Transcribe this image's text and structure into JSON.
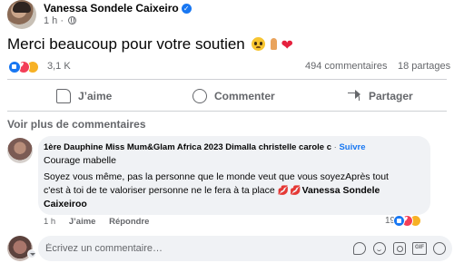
{
  "post": {
    "author": "Vanessa Sondele Caixeiro",
    "time": "1 h",
    "time_sep": "·",
    "text": "Merci beaucoup pour votre soutien",
    "reaction_count": "3,1 K",
    "comments_count": "494 commentaires",
    "shares_count": "18 partages"
  },
  "actions": {
    "like": "J’aime",
    "comment": "Commenter",
    "share": "Partager"
  },
  "comments_section": {
    "see_more": "Voir plus de commentaires"
  },
  "comment": {
    "author": "1ère Dauphine Miss Mum&Glam Africa 2023 Dimalla christelle carole c",
    "sep": "·",
    "follow": "Suivre",
    "line1": "Courage mabelle",
    "line2": "Soyez vous même, pas la personne que le monde veut que vous soyezAprès tout",
    "line3": "c'est à toi de te valoriser personne ne le fera à ta place",
    "mention": "Vanessa Sondele",
    "line4": "Caixeiroo",
    "time": "1 h",
    "like": "J’aime",
    "reply": "Répondre",
    "reaction_count": "19"
  },
  "composer": {
    "placeholder": "Écrivez un commentaire…"
  },
  "colors": {
    "link_blue": "#1877f2",
    "muted_text": "#65676b",
    "bubble_bg": "#f0f2f5"
  },
  "icons": [
    "verified-icon",
    "globe-icon",
    "like-icon",
    "comment-icon",
    "share-icon",
    "sticker-icon",
    "emoji-icon",
    "camera-icon",
    "gif-icon",
    "avatar-sticker-icon"
  ]
}
